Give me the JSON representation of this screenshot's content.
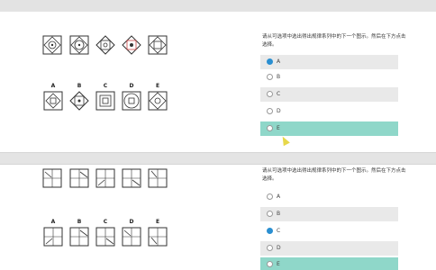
{
  "questions": [
    {
      "prompt": "请从可选项中选出得出规律系列中的下一个图示。然后在下方点击选择。",
      "sequence_icons": [
        "square-rotated-circle-figure",
        "square-diamond-circle-figure",
        "diamond-square-figure",
        "diamond-square-figure",
        "square-diamond-figure"
      ],
      "answer_letters": [
        "A",
        "B",
        "C",
        "D",
        "E"
      ],
      "options": [
        {
          "label": "A",
          "selected": true,
          "highlighted": false
        },
        {
          "label": "B",
          "selected": false,
          "highlighted": false
        },
        {
          "label": "C",
          "selected": false,
          "highlighted": false
        },
        {
          "label": "D",
          "selected": false,
          "highlighted": false
        },
        {
          "label": "E",
          "selected": false,
          "highlighted": true
        }
      ]
    },
    {
      "prompt": "请从可选项中选出得出规律系列中的下一个图示。然后在下方点击选择。",
      "answer_letters": [
        "A",
        "B",
        "C",
        "D",
        "E"
      ],
      "options": [
        {
          "label": "A",
          "selected": false,
          "highlighted": false
        },
        {
          "label": "B",
          "selected": false,
          "highlighted": false
        },
        {
          "label": "C",
          "selected": true,
          "highlighted": false
        },
        {
          "label": "D",
          "selected": false,
          "highlighted": false
        },
        {
          "label": "E",
          "selected": false,
          "highlighted": true
        }
      ]
    }
  ],
  "colors": {
    "selected": "#2a8fd1",
    "highlight": "#8fd7c9",
    "option_bg": "#e9e9e9",
    "separator": "#e4e4e4"
  }
}
